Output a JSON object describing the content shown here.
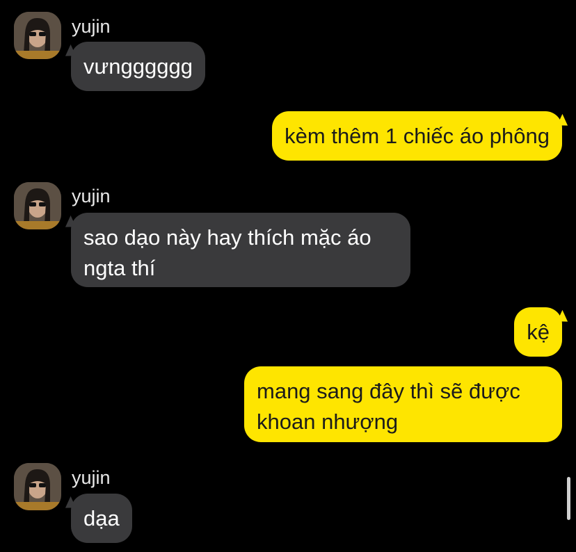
{
  "colors": {
    "background": "#000000",
    "incoming_bubble": "#3a3a3c",
    "outgoing_bubble": "#fee500",
    "outgoing_text": "#1b1b1b"
  },
  "messages": [
    {
      "direction": "in",
      "sender": "yujin",
      "text": "vưngggggg"
    },
    {
      "direction": "out",
      "text": "kèm thêm 1 chiếc áo phông"
    },
    {
      "direction": "in",
      "sender": "yujin",
      "text": "sao dạo này hay thích mặc áo ngta thí"
    },
    {
      "direction": "out",
      "text": "kệ"
    },
    {
      "direction": "out",
      "text": "mang sang đây thì sẽ được khoan nhượng"
    },
    {
      "direction": "in",
      "sender": "yujin",
      "text": "dạa"
    }
  ]
}
